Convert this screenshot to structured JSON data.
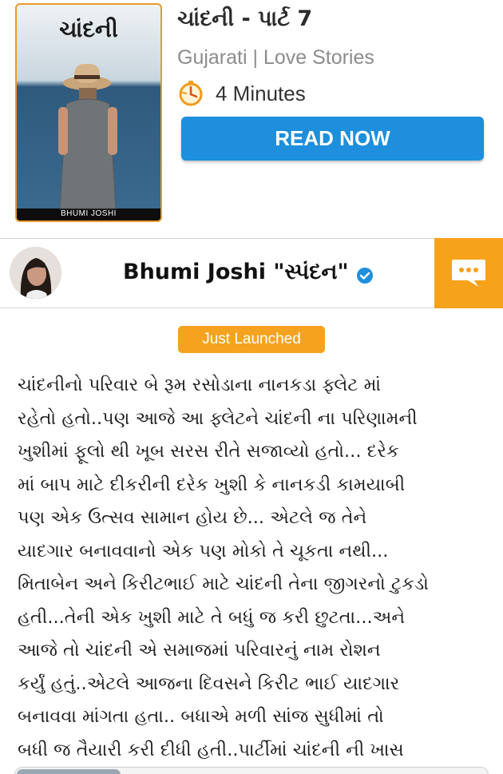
{
  "book": {
    "title": "ચાંદની - પાર્ટ 7",
    "meta": "Gujarati | Love Stories",
    "read_time": "4  Minutes",
    "read_button": "READ NOW",
    "cover_title": "ચાંદની",
    "cover_author": "BHUMI JOSHI"
  },
  "author": {
    "name": "Bhumi Joshi \"સ્પંદન\""
  },
  "badge": "Just Launched",
  "story_lines": [
    "ચાંદનીનો પરિવાર બે રૂમ રસોડાના નાનકડા ફ્લેટ માં",
    "રહેતો હતો..પણ આજે આ ફ્લેટને ચાંદની ના પરિણામની",
    "ખુશીમાં ફૂલો થી ખૂબ સરસ રીતે સજાવ્યો હતો... દરેક",
    "માં બાપ માટે દીકરીની દરેક ખુશી કે નાનકડી કામયાબી",
    "પણ એક ઉત્સવ સામાન હોય છે... એટલે જ તેને",
    "યાદગાર બનાવવાનો એક પણ મોકો તે ચૂકતા નથી...",
    "મિતાબેન અને કિરીટભાઈ માટે ચાંદની તેના જીગરનો ટુકડો",
    "હતી...તેની એક ખુશી માટે તે બધું જ કરી છુટતા...અને",
    "આજે તો ચાંદની એ સમાજમાં  પરિવારનું નામ રોશન",
    "કર્યું હતું..એટલે આજના દિવસને કિરીટ ભાઈ યાદગાર",
    "બનાવવા માંગતા હતા.. બધાએ મળી સાંજ સુધીમાં તો",
    "બધી જ તૈયારી કરી દીધી હતી..પાર્ટીમાં ચાંદની ની ખાસ"
  ],
  "colors": {
    "accent_blue": "#1d8fdc",
    "accent_orange": "#f7a21b",
    "cover_border": "#e89a2c"
  },
  "icons": [
    "timer-icon",
    "verified-icon",
    "chat-icon"
  ]
}
